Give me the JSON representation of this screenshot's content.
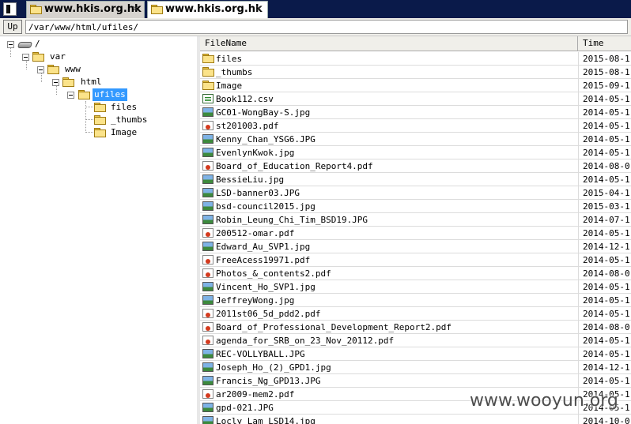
{
  "tabs": [
    {
      "label": "www.hkis.org.hk",
      "close": "×",
      "active": false
    },
    {
      "label": "www.hkis.org.hk",
      "close": "×",
      "active": true
    }
  ],
  "toolbar": {
    "up_label": "Up",
    "path": "/var/www/html/ufiles/"
  },
  "tree": {
    "root": "/",
    "var": "var",
    "www": "www",
    "html": "html",
    "ufiles": "ufiles",
    "children": [
      "files",
      "_thumbs",
      "Image"
    ]
  },
  "columns": {
    "name": "FileName",
    "time": "Time"
  },
  "files": [
    {
      "name": "files",
      "time": "2015-08-1",
      "type": "folder"
    },
    {
      "name": "_thumbs",
      "time": "2015-08-1",
      "type": "folder"
    },
    {
      "name": "Image",
      "time": "2015-09-1",
      "type": "folder"
    },
    {
      "name": "Book112.csv",
      "time": "2014-05-1",
      "type": "csv"
    },
    {
      "name": "GC01-WongBay-S.jpg",
      "time": "2014-05-1",
      "type": "image"
    },
    {
      "name": "st201003.pdf",
      "time": "2014-05-1",
      "type": "pdf"
    },
    {
      "name": "Kenny_Chan_YSG6.JPG",
      "time": "2014-05-1",
      "type": "image"
    },
    {
      "name": "EvenlynKwok.jpg",
      "time": "2014-05-1",
      "type": "image"
    },
    {
      "name": "Board_of_Education_Report4.pdf",
      "time": "2014-08-0",
      "type": "pdf"
    },
    {
      "name": "BessieLiu.jpg",
      "time": "2014-05-1",
      "type": "image"
    },
    {
      "name": "LSD-banner03.JPG",
      "time": "2015-04-1",
      "type": "image"
    },
    {
      "name": "bsd-council2015.jpg",
      "time": "2015-03-1",
      "type": "image"
    },
    {
      "name": "Robin_Leung_Chi_Tim_BSD19.JPG",
      "time": "2014-07-1",
      "type": "image"
    },
    {
      "name": "200512-omar.pdf",
      "time": "2014-05-1",
      "type": "pdf"
    },
    {
      "name": "Edward_Au_SVP1.jpg",
      "time": "2014-12-1",
      "type": "image"
    },
    {
      "name": "FreeAcess19971.pdf",
      "time": "2014-05-1",
      "type": "pdf"
    },
    {
      "name": "Photos_&_contents2.pdf",
      "time": "2014-08-0",
      "type": "pdf"
    },
    {
      "name": "Vincent_Ho_SVP1.jpg",
      "time": "2014-05-1",
      "type": "image"
    },
    {
      "name": "JeffreyWong.jpg",
      "time": "2014-05-1",
      "type": "image"
    },
    {
      "name": "2011st06_5d_pdd2.pdf",
      "time": "2014-05-1",
      "type": "pdf"
    },
    {
      "name": "Board_of_Professional_Development_Report2.pdf",
      "time": "2014-08-0",
      "type": "pdf"
    },
    {
      "name": "agenda_for_SRB_on_23_Nov_20112.pdf",
      "time": "2014-05-1",
      "type": "pdf"
    },
    {
      "name": "REC-VOLLYBALL.JPG",
      "time": "2014-05-1",
      "type": "image"
    },
    {
      "name": "Joseph_Ho_(2)_GPD1.jpg",
      "time": "2014-12-1",
      "type": "image"
    },
    {
      "name": "Francis_Ng_GPD13.JPG",
      "time": "2014-05-1",
      "type": "image"
    },
    {
      "name": "ar2009-mem2.pdf",
      "time": "2014-05-1",
      "type": "pdf"
    },
    {
      "name": "gpd-021.JPG",
      "time": "2014-05-1",
      "type": "image"
    },
    {
      "name": "Locly_Lam_LSD14.jpg",
      "time": "2014-10-0",
      "type": "image"
    }
  ],
  "watermark": "www.wooyun.org"
}
